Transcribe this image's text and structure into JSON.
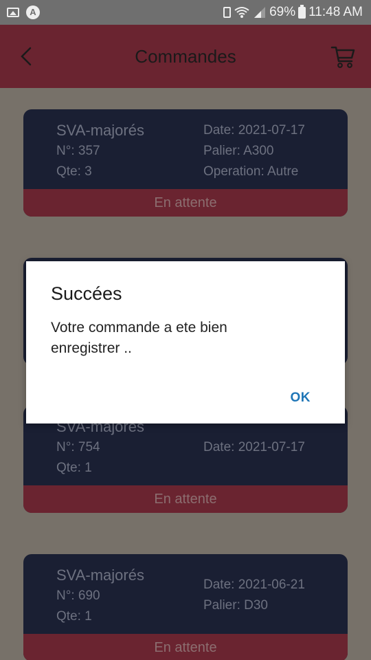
{
  "status_bar": {
    "battery": "69%",
    "time": "11:48 AM",
    "icons": [
      "image-icon",
      "a-icon",
      "battery-saver-icon",
      "wifi-icon",
      "signal-icon",
      "battery-icon"
    ]
  },
  "app_bar": {
    "title": "Commandes",
    "back_icon": "chevron-left-icon",
    "cart_icon": "cart-icon"
  },
  "orders": [
    {
      "name": "SVA-majorés",
      "number": "N°: 357",
      "qty": "Qte: 3",
      "date": "Date: 2021-07-17",
      "palier": "Palier: A300",
      "operation": "Operation: Autre",
      "status": "En attente"
    },
    {
      "name": "SVA-majorés",
      "number": "N°: 754",
      "qty": "Qte: 1",
      "date": "Date: 2021-07-17",
      "status": "En attente"
    },
    {
      "name": "SVA-majorés",
      "number": "N°: 690",
      "qty": "Qte: 1",
      "date": "Date: 2021-06-21",
      "palier": "Palier: D30",
      "status": "En attente"
    }
  ],
  "dialog": {
    "title": "Succées",
    "message": "Votre commande a ete bien enregistrer ..",
    "ok_label": "OK"
  },
  "colors": {
    "app_bar": "#6a2430",
    "card": "#1a1f33",
    "status_strip": "#6a2430",
    "background": "#777169",
    "ok_button": "#1f76b7"
  }
}
